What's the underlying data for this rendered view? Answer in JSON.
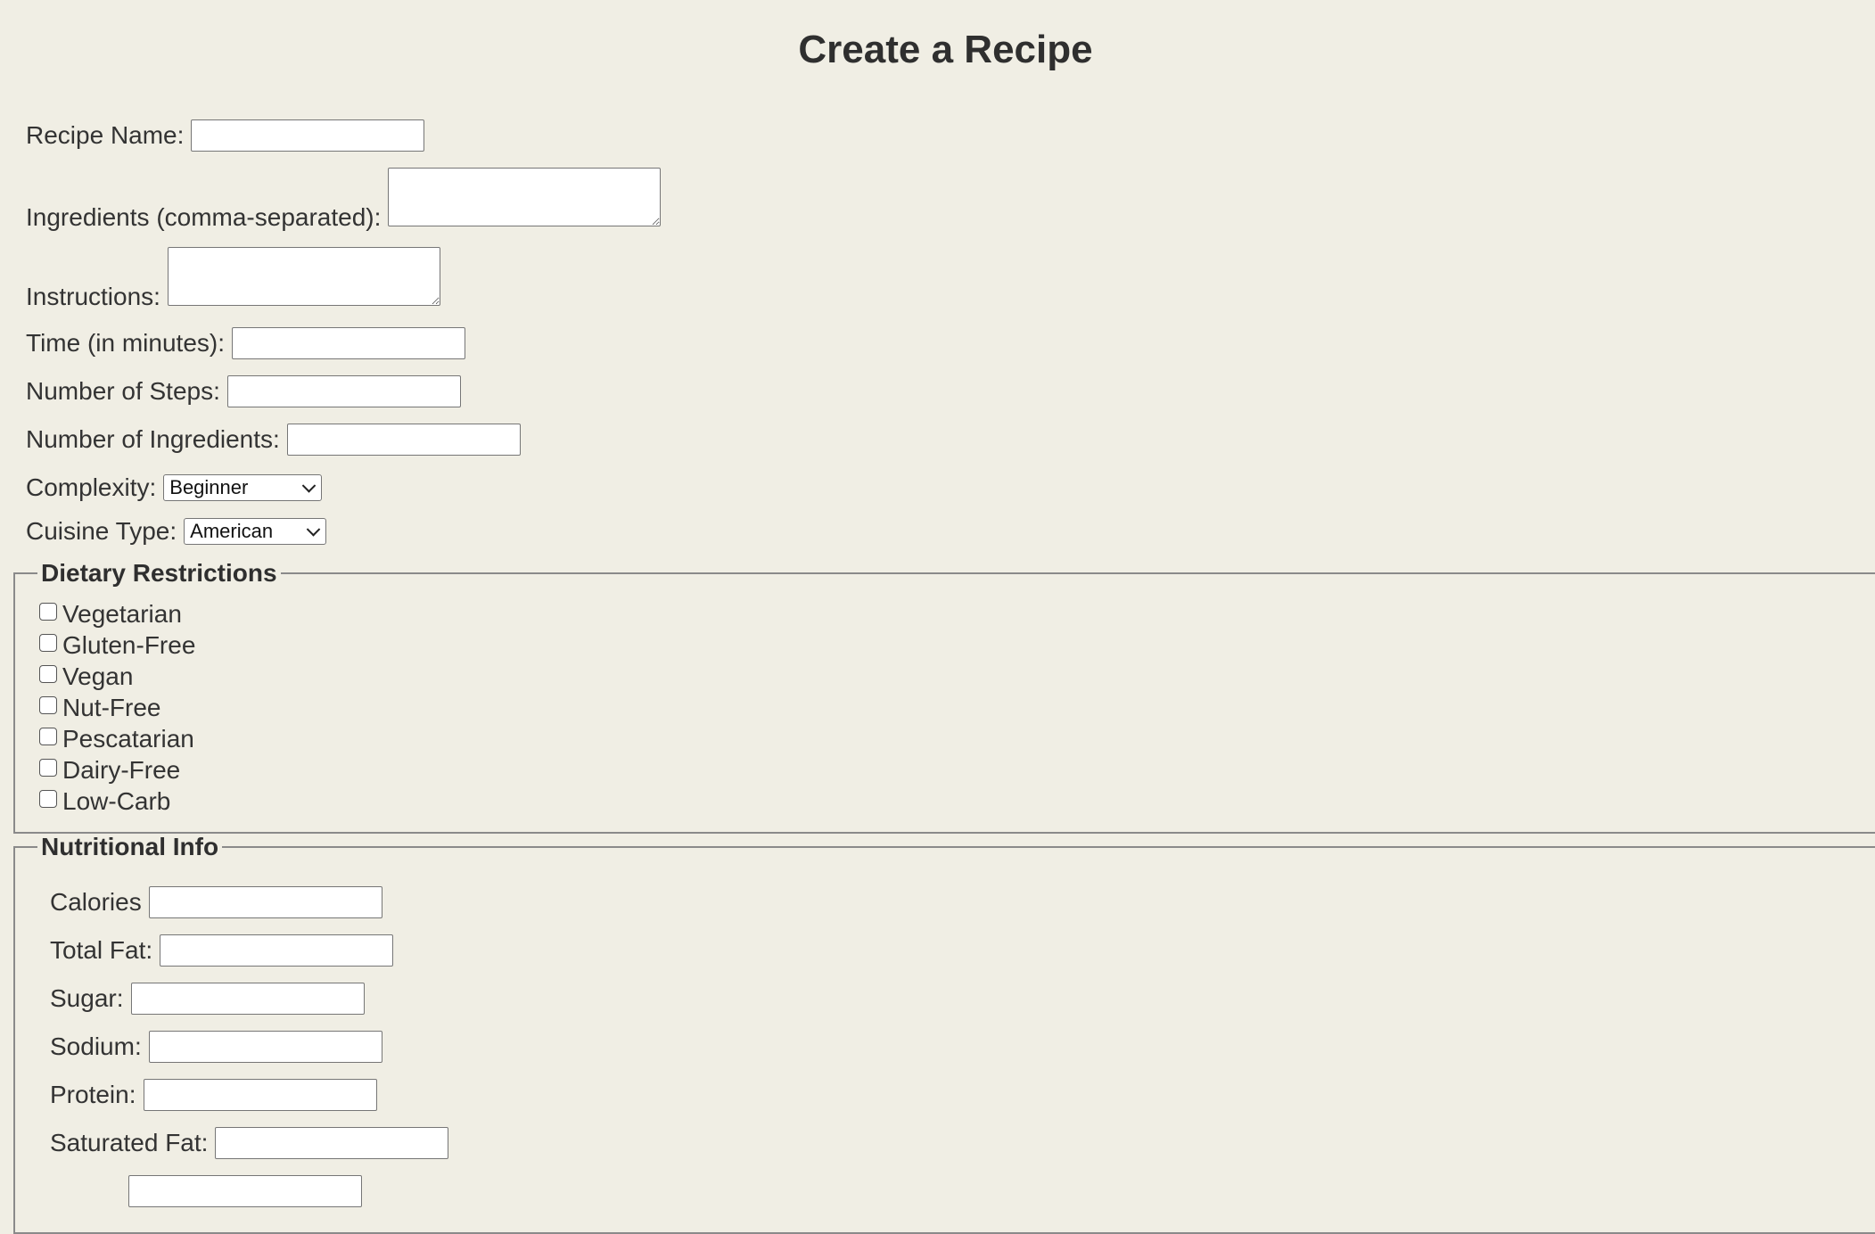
{
  "title": "Create a Recipe",
  "fields": {
    "recipe_name": {
      "label": "Recipe Name:",
      "value": "",
      "placeholder": ""
    },
    "ingredients": {
      "label": "Ingredients (comma-separated):",
      "value": ""
    },
    "instructions": {
      "label": "Instructions:",
      "value": ""
    },
    "time": {
      "label": "Time (in minutes):",
      "value": ""
    },
    "steps": {
      "label": "Number of Steps:",
      "value": ""
    },
    "num_ingredients": {
      "label": "Number of Ingredients:",
      "value": ""
    },
    "complexity": {
      "label": "Complexity:",
      "selected": "Beginner"
    },
    "cuisine": {
      "label": "Cuisine Type:",
      "selected": "American"
    }
  },
  "dietary": {
    "legend": "Dietary Restrictions",
    "options": [
      {
        "label": "Vegetarian",
        "checked": false
      },
      {
        "label": "Gluten-Free",
        "checked": false
      },
      {
        "label": "Vegan",
        "checked": false
      },
      {
        "label": "Nut-Free",
        "checked": false
      },
      {
        "label": "Pescatarian",
        "checked": false
      },
      {
        "label": "Dairy-Free",
        "checked": false
      },
      {
        "label": "Low-Carb",
        "checked": false
      }
    ]
  },
  "nutrition": {
    "legend": "Nutritional Info",
    "fields": [
      {
        "label": "Calories",
        "value": ""
      },
      {
        "label": "Total Fat:",
        "value": ""
      },
      {
        "label": "Sugar:",
        "value": ""
      },
      {
        "label": "Sodium:",
        "value": ""
      },
      {
        "label": "Protein:",
        "value": ""
      },
      {
        "label": "Saturated Fat:",
        "value": ""
      },
      {
        "label": "",
        "value": ""
      }
    ]
  },
  "colors": {
    "background": "#f0eee4",
    "text": "#333333",
    "border": "#767676",
    "fieldset_border": "#8a8a8a"
  }
}
